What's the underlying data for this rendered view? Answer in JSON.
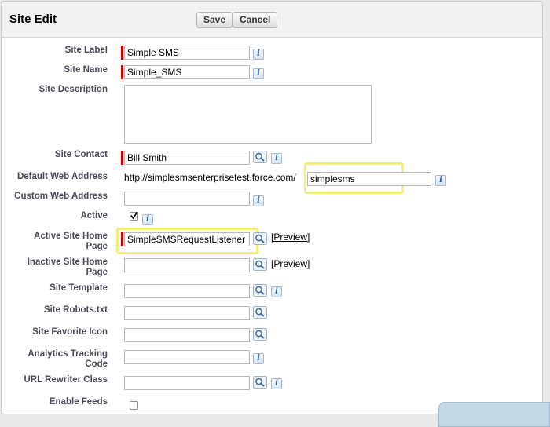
{
  "header": {
    "title": "Site Edit",
    "save_label": "Save",
    "cancel_label": "Cancel"
  },
  "fields": {
    "site_label": {
      "label": "Site Label",
      "value": "Simple SMS"
    },
    "site_name": {
      "label": "Site Name",
      "value": "Simple_SMS"
    },
    "site_description": {
      "label": "Site Description",
      "value": ""
    },
    "site_contact": {
      "label": "Site Contact",
      "value": "Bill Smith"
    },
    "default_web_address": {
      "label": "Default Web Address",
      "prefix": "http://simplesmsenterprisetest.force.com/",
      "value": "simplesms"
    },
    "custom_web_address": {
      "label": "Custom Web Address",
      "value": ""
    },
    "active": {
      "label": "Active",
      "checked": true
    },
    "active_home": {
      "label1": "Active Site Home",
      "label2": "Page",
      "value": "SimpleSMSRequestListener",
      "preview": "[Preview]"
    },
    "inactive_home": {
      "label1": "Inactive Site Home",
      "label2": "Page",
      "value": "",
      "preview": "[Preview]"
    },
    "site_template": {
      "label": "Site Template",
      "value": ""
    },
    "site_robots": {
      "label": "Site Robots.txt",
      "value": ""
    },
    "favorite_icon": {
      "label": "Site Favorite Icon",
      "value": ""
    },
    "analytics": {
      "label1": "Analytics Tracking",
      "label2": "Code",
      "value": ""
    },
    "url_rewriter": {
      "label": "URL Rewriter Class",
      "value": ""
    },
    "enable_feeds": {
      "label": "Enable Feeds",
      "checked": false
    }
  },
  "icons": {
    "info": "info-icon",
    "lookup": "lookup-magnifier-icon"
  },
  "colors": {
    "required": "#cc0000",
    "highlight": "#f2ef7c",
    "label": "#4a4a56"
  }
}
